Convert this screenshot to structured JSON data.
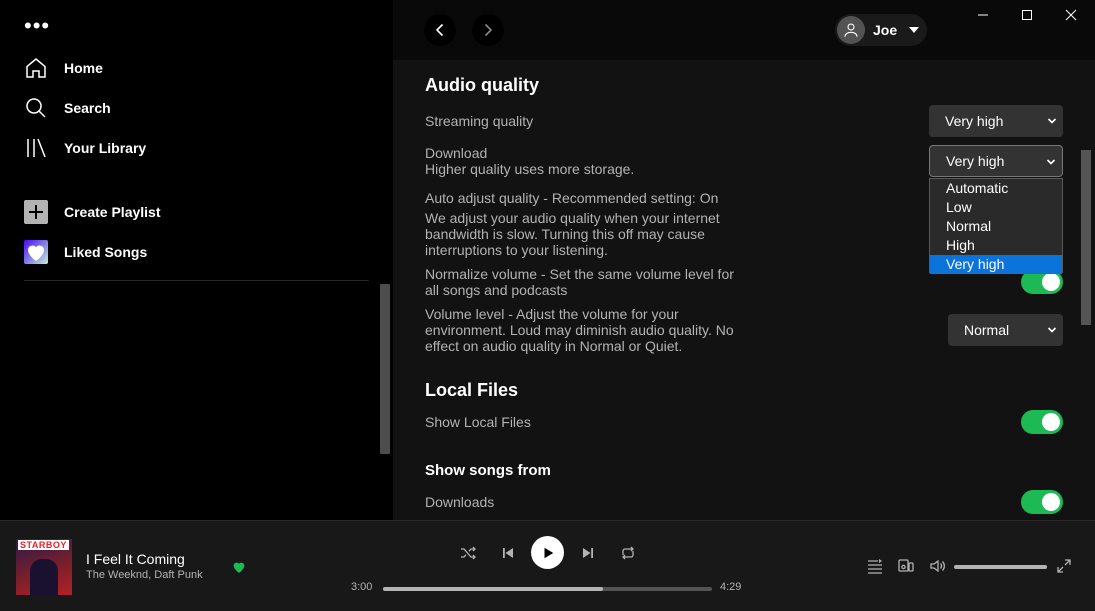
{
  "sidebar": {
    "menu_glyph": "•••",
    "nav": [
      {
        "label": "Home",
        "icon": "home-icon"
      },
      {
        "label": "Search",
        "icon": "search-icon"
      },
      {
        "label": "Your Library",
        "icon": "library-icon"
      }
    ],
    "actions": [
      {
        "label": "Create Playlist",
        "icon": "plus-icon"
      },
      {
        "label": "Liked Songs",
        "icon": "heart-icon"
      }
    ]
  },
  "header": {
    "user_name": "Joe"
  },
  "settings": {
    "audio_quality": {
      "title": "Audio quality",
      "streaming_label": "Streaming quality",
      "streaming_value": "Very high",
      "download_label": "Download",
      "download_desc": "Higher quality uses more storage.",
      "download_value": "Very high",
      "download_options": [
        "Automatic",
        "Low",
        "Normal",
        "High",
        "Very high"
      ],
      "download_selected_index": 4,
      "auto_adjust_label": "Auto adjust quality - Recommended setting: On",
      "auto_adjust_desc": "We adjust your audio quality when your internet bandwidth is slow. Turning this off may cause interruptions to your listening.",
      "normalize_label": "Normalize volume - Set the same volume level for all songs and podcasts",
      "normalize_on": true,
      "volume_level_label": "Volume level - Adjust the volume for your environment. Loud may diminish audio quality. No effect on audio quality in Normal or Quiet.",
      "volume_level_value": "Normal"
    },
    "local_files": {
      "title": "Local Files",
      "show_local_label": "Show Local Files",
      "show_local_on": true
    },
    "show_songs_from": {
      "title": "Show songs from",
      "downloads_label": "Downloads",
      "downloads_on": true
    }
  },
  "player": {
    "cover_text": "STARBOY",
    "track_title": "I Feel It Coming",
    "track_artist": "The Weeknd, Daft Punk",
    "liked": true,
    "elapsed": "3:00",
    "duration": "4:29",
    "progress_fraction": 0.67,
    "volume_fraction": 1.0
  },
  "colors": {
    "accent": "#1db954",
    "selected_option": "#0a74da",
    "main_bg": "#121212",
    "sidebar_bg": "#000000",
    "player_bg": "#181818"
  }
}
